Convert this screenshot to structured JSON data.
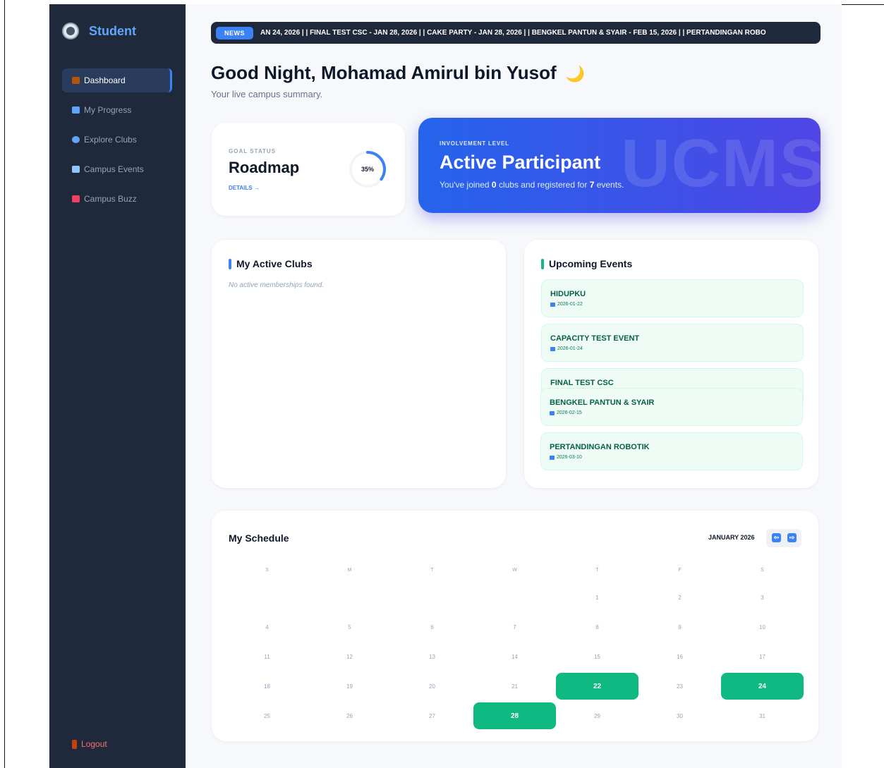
{
  "sidebar": {
    "brand": "Student",
    "items": [
      {
        "label": "Dashboard",
        "icon": "home-icon",
        "icon_color": "#b45309",
        "active": true
      },
      {
        "label": "My Progress",
        "icon": "chart-icon",
        "icon_color": "#60a5fa",
        "active": false
      },
      {
        "label": "Explore Clubs",
        "icon": "search-icon",
        "icon_color": "#60a5fa",
        "active": false
      },
      {
        "label": "Campus Events",
        "icon": "calendar-icon",
        "icon_color": "#93c5fd",
        "active": false
      },
      {
        "label": "Campus Buzz",
        "icon": "megaphone-icon",
        "icon_color": "#f43f5e",
        "active": false
      }
    ],
    "logout": "Logout"
  },
  "ticker": {
    "badge": "NEWS",
    "text": "AN 24, 2026 | | FINAL TEST CSC - JAN 28, 2026 | | CAKE PARTY - JAN 28, 2026 | | BENGKEL PANTUN & SYAIR - FEB 15, 2026 | | PERTANDINGAN ROBO"
  },
  "greeting": {
    "title": "Good Night, Mohamad Amirul bin Yusof",
    "emoji": "🌙",
    "subtitle": "Your live campus summary."
  },
  "goal": {
    "label": "GOAL STATUS",
    "title": "Roadmap",
    "link": "DETAILS →",
    "percent_text": "35%",
    "percent": 35
  },
  "involvement": {
    "label": "INVOLVEMENT LEVEL",
    "title": "Active Participant",
    "desc_pre": "You've joined ",
    "clubs": "0",
    "desc_mid": " clubs and registered for ",
    "events": "7",
    "desc_post": " events.",
    "watermark": "UCMS"
  },
  "clubs": {
    "title": "My Active Clubs",
    "empty": "No active memberships found."
  },
  "events": {
    "title": "Upcoming Events",
    "items": [
      {
        "name": "HIDUPKU",
        "date": "2026-01-22"
      },
      {
        "name": "CAPACITY TEST EVENT",
        "date": "2026-01-24"
      },
      {
        "name": "FINAL TEST CSC",
        "date": ""
      },
      {
        "name": "BENGKEL PANTUN & SYAIR",
        "date": "2026-02-15"
      },
      {
        "name": "PERTANDINGAN ROBOTIK",
        "date": "2026-03-10"
      }
    ]
  },
  "schedule": {
    "title": "My Schedule",
    "month": "JANUARY 2026",
    "prev": "⇦",
    "next": "⇨",
    "weekdays": [
      "S",
      "M",
      "T",
      "W",
      "T",
      "F",
      "S"
    ],
    "days": [
      "1",
      "2",
      "3",
      "4",
      "5",
      "6",
      "7",
      "8",
      "9",
      "10",
      "11",
      "12",
      "13",
      "14",
      "15",
      "16",
      "17",
      "18",
      "19",
      "20",
      "21",
      "22",
      "23",
      "24",
      "25",
      "26",
      "27",
      "28",
      "29",
      "30",
      "31"
    ],
    "highlighted": [
      "22",
      "24",
      "28"
    ],
    "highlight_color": "#10b981"
  }
}
